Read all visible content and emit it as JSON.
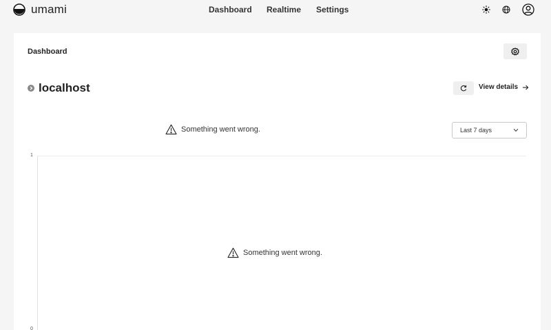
{
  "app": {
    "name": "umami"
  },
  "nav": {
    "items": [
      "Dashboard",
      "Realtime",
      "Settings"
    ]
  },
  "header_icons": [
    "sun-icon",
    "globe-icon",
    "user-icon"
  ],
  "page": {
    "title": "Dashboard"
  },
  "website": {
    "name": "localhost",
    "view_details_label": "View details"
  },
  "filters": {
    "date_range": "Last 7 days"
  },
  "errors": {
    "message": "Something went wrong."
  },
  "chart": {
    "y_ticks": [
      "1",
      "0"
    ]
  },
  "colors": {
    "background": "#f5f5f5",
    "card": "#ffffff",
    "button": "#efefef"
  }
}
